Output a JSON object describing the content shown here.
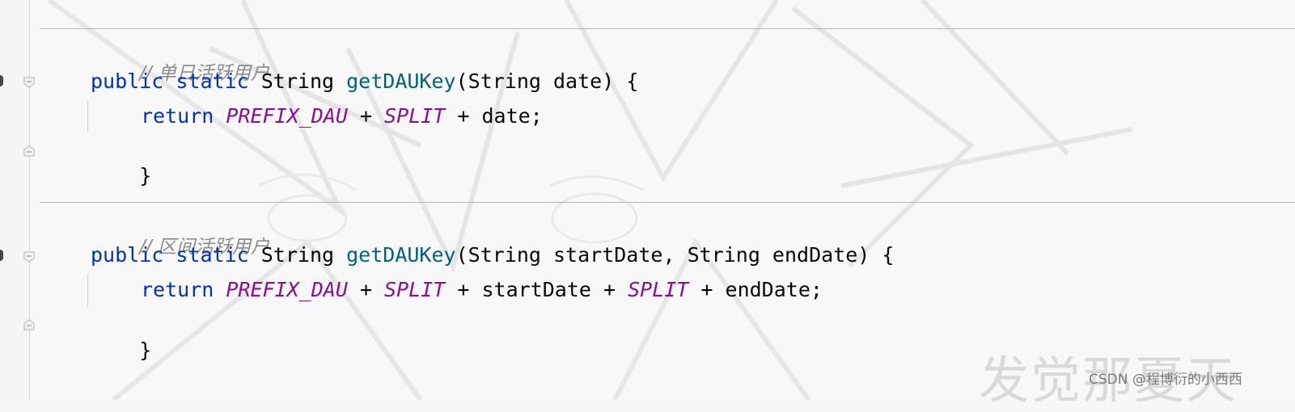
{
  "editor": {
    "blocks": [
      {
        "comment": "// 单日活跃用户",
        "signature": {
          "kw1": "public",
          "kw2": "static",
          "type": "String",
          "method": "getDAUKey",
          "params": "(String date) {"
        },
        "body": {
          "kw": "return",
          "field1": "PREFIX_DAU",
          "op1": " + ",
          "field2": "SPLIT",
          "rest": " + date;"
        },
        "close": "}"
      },
      {
        "comment": "// 区间活跃用户",
        "signature": {
          "kw1": "public",
          "kw2": "static",
          "type": "String",
          "method": "getDAUKey",
          "params": "(String startDate, String endDate) {"
        },
        "body": {
          "kw": "return",
          "field1": "PREFIX_DAU",
          "op1": " + ",
          "field2": "SPLIT",
          "mid": " + startDate + ",
          "field3": "SPLIT",
          "rest": " + endDate;"
        },
        "close": "}"
      }
    ]
  },
  "watermark": {
    "text": "CSDN @程博衍的小西西",
    "faint_text": "发觉那夏天"
  },
  "colors": {
    "keyword": "#0033b3",
    "method": "#00627a",
    "field": "#871094",
    "comment": "#8c8c8c"
  }
}
